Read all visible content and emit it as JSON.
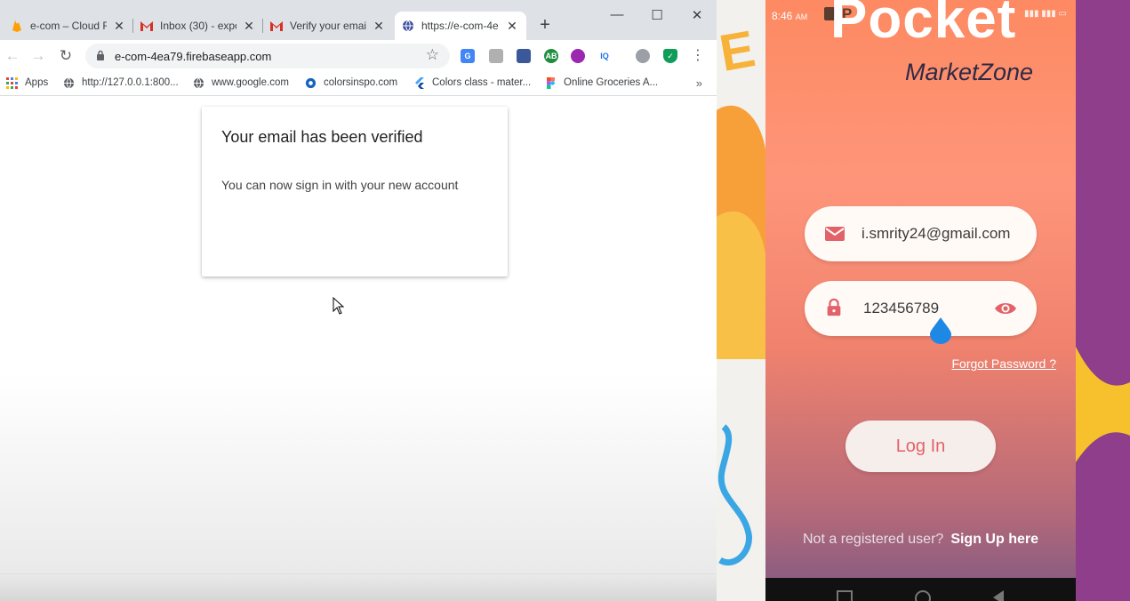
{
  "browser": {
    "tabs": [
      {
        "title": "e-com – Cloud F",
        "close": "✕"
      },
      {
        "title": "Inbox (30) - expo",
        "close": "✕"
      },
      {
        "title": "Verify your email",
        "close": "✕"
      },
      {
        "title": "https://e-com-4e",
        "close": "✕"
      }
    ],
    "new_tab": "+",
    "window_controls": {
      "minimize": "—",
      "maximize": "☐",
      "close": "✕"
    },
    "nav": {
      "back": "←",
      "forward": "→",
      "reload": "↻"
    },
    "url": "e-com-4ea79.firebaseapp.com",
    "bookmark_star": "☆",
    "bookmarks": [
      {
        "label": "Apps",
        "icon": "apps-grid-icon"
      },
      {
        "label": "http://127.0.0.1:800...",
        "icon": "globe-icon"
      },
      {
        "label": "www.google.com",
        "icon": "globe-icon"
      },
      {
        "label": "colorsinspo.com",
        "icon": "colorsinspo-icon"
      },
      {
        "label": "Colors class - mater...",
        "icon": "flutter-icon"
      },
      {
        "label": "Online Groceries A...",
        "icon": "figma-icon"
      }
    ],
    "bookmarks_more": "»"
  },
  "card": {
    "title": "Your email has been verified",
    "message": "You can now sign in with your new account"
  },
  "phone": {
    "status_time": "8:46",
    "status_ampm": "AM",
    "status_p": "P",
    "app_title": "Pocket",
    "app_subtitle": "MarketZone",
    "email_value": "i.smrity24@gmail.com",
    "password_value": "123456789",
    "forgot_password": "Forgot Password ?",
    "login_label": "Log In",
    "signup_question": "Not a registered user?",
    "signup_link": "Sign Up here"
  },
  "colors": {
    "accent_red": "#e2626a",
    "screen_top": "#fd8a62",
    "screen_bottom": "#8d5d80"
  }
}
